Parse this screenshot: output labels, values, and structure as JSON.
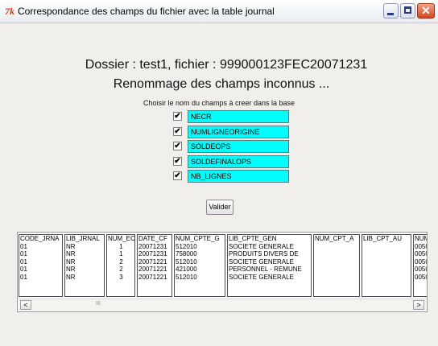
{
  "window": {
    "title": "Correspondance des champs du fichier avec la table journal",
    "app_icon_glyph": "7k",
    "close_glyph": "✕"
  },
  "main": {
    "heading": "Dossier : test1, fichier : 999000123FEC20071231",
    "subheading": "Renommage des champs inconnus  ...",
    "instruction": "Choisir le nom du champs à creer dans la base",
    "fields": [
      {
        "checked": true,
        "check_glyph": "✔",
        "value": "NECR"
      },
      {
        "checked": true,
        "check_glyph": "✔",
        "value": "NUMLIGNEORIGINE"
      },
      {
        "checked": true,
        "check_glyph": "✔",
        "value": "SOLDEOPS"
      },
      {
        "checked": true,
        "check_glyph": "✔",
        "value": "SOLDEFINALOPS"
      },
      {
        "checked": true,
        "check_glyph": "✔",
        "value": "NB_LIGNES"
      }
    ],
    "submit_label": "Valider"
  },
  "grid": {
    "columns": [
      {
        "header": "CODE_JRNA",
        "cells": [
          "01",
          "01",
          "01",
          "01",
          "01"
        ]
      },
      {
        "header": "LIB_JRNAL",
        "cells": [
          "NR",
          "NR",
          "NR",
          "NR",
          "NR"
        ]
      },
      {
        "header": "NUM_EC",
        "cells": [
          "1",
          "1",
          "2",
          "2",
          "3"
        ]
      },
      {
        "header": "DATE_CF",
        "cells": [
          "20071231",
          "20071231",
          "20071221",
          "20071221",
          "20071221"
        ]
      },
      {
        "header": "NUM_CPTE_G",
        "cells": [
          "512010",
          "758000",
          "512010",
          "421000",
          "512010"
        ]
      },
      {
        "header": "LIB_CPTE_GEN",
        "cells": [
          "SOCIETE GENERALE",
          "PRODUITS DIVERS DE",
          "SOCIETE GENERALE",
          "PERSONNEL - REMUNE",
          "SOCIETE GENERALE"
        ]
      },
      {
        "header": "NUM_CPT_A",
        "cells": []
      },
      {
        "header": "LIB_CPT_AU",
        "cells": []
      },
      {
        "header": "NUM",
        "cells": [
          "0050",
          "0050",
          "0050",
          "0050",
          "0050"
        ]
      }
    ],
    "scroll_left_glyph": "<",
    "scroll_right_glyph": ">",
    "scroll_thumb_glyph": "III"
  }
}
